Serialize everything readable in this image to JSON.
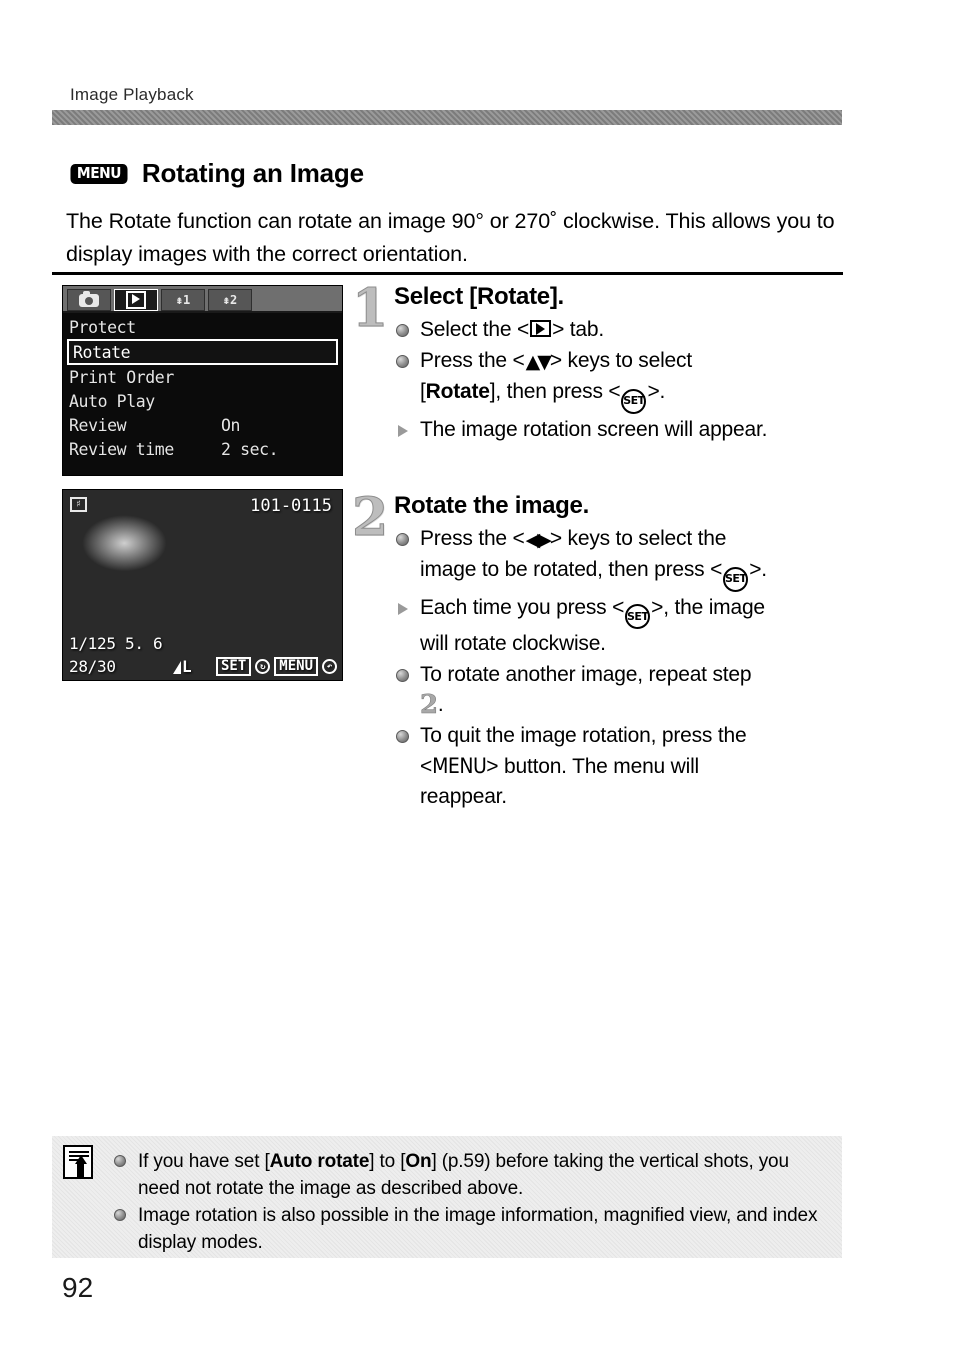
{
  "header": {
    "running_head": "Image Playback"
  },
  "section": {
    "badge": "MENU",
    "title": "Rotating an Image",
    "intro": "The Rotate function can rotate an image 90° or 270˚ clockwise. This allows you to display images with the correct orientation."
  },
  "menu_screen": {
    "tabs": [
      {
        "icon": "camera-icon",
        "label": "",
        "active": false
      },
      {
        "icon": "playback-icon",
        "label": "",
        "active": true
      },
      {
        "icon": "wrench-icon",
        "label": "1",
        "active": false
      },
      {
        "icon": "wrench-icon",
        "label": "2",
        "active": false
      }
    ],
    "items": [
      {
        "label": "Protect",
        "value": "",
        "selected": false
      },
      {
        "label": "Rotate",
        "value": "",
        "selected": true
      },
      {
        "label": "Print Order",
        "value": "",
        "selected": false
      },
      {
        "label": "Auto Play",
        "value": "",
        "selected": false
      },
      {
        "label": "Review",
        "value": "On",
        "selected": false
      },
      {
        "label": "Review time",
        "value": "2 sec.",
        "selected": false
      }
    ]
  },
  "photo_screen": {
    "protect_icon": "protect-icon",
    "file_number": "101-0115",
    "exposure": "1/125   5. 6",
    "frame_count": "28/30",
    "quality": "L",
    "set_hint": "SET",
    "menu_hint": "MENU"
  },
  "steps": [
    {
      "number": "1",
      "title": "Select [Rotate].",
      "lines": [
        {
          "marker": "dot",
          "before": "Select the <",
          "glyph": "play-tab-icon",
          "after": "> tab."
        },
        {
          "marker": "dot",
          "before": "Press the <",
          "glyph": "up-down-arrows-icon",
          "after": "> keys to select [Rotate], then press <",
          "glyph2": "set-button-icon",
          "after2": ">."
        },
        {
          "marker": "triangle",
          "before": "The image rotation screen will appear.",
          "glyph": "",
          "after": ""
        }
      ]
    },
    {
      "number": "2",
      "title": "Rotate the image.",
      "lines": [
        {
          "marker": "dot",
          "before": "Press the <",
          "glyph": "left-right-arrows-icon",
          "after": "> keys to select the image to be rotated, then press <",
          "glyph2": "set-button-icon",
          "after2": ">."
        },
        {
          "marker": "triangle",
          "before": "Each time you press <",
          "glyph": "set-button-icon",
          "after": ">, the image will rotate clockwise."
        },
        {
          "marker": "dot",
          "before": "To rotate another image, repeat step",
          "glyph": "step-2-ref",
          "after": "."
        },
        {
          "marker": "dot",
          "before": "To quit the image rotation, press the <",
          "glyph": "menu-word",
          "after": "> button. The menu will reappear."
        }
      ]
    }
  ],
  "step_labels": {
    "s1_title": "Select [Rotate].",
    "s1_b1_a": "Select the <",
    "s1_b1_b": "> tab.",
    "s1_b2_a": "Press the <",
    "s1_b2_b": "> keys to select",
    "s1_b2_c": "[",
    "s1_b2_rotate": "Rotate",
    "s1_b2_d": "], then press <",
    "s1_b2_e": ">.",
    "s1_b3": "The image rotation screen will appear.",
    "s2_title": "Rotate the image.",
    "s2_b1_a": "Press the <",
    "s2_b1_b": "> keys to select the",
    "s2_b1_c": "image to be rotated, then press <",
    "s2_b1_d": ">.",
    "s2_b2_a": "Each time you press <",
    "s2_b2_b": ">, the image",
    "s2_b2_c": "will rotate clockwise.",
    "s2_b3_a": "To rotate another image, repeat step",
    "s2_b3_num": "2",
    "s2_b3_b": ".",
    "s2_b4_a": "To quit the image rotation, press the",
    "s2_b4_lt": "<",
    "s2_b4_menu": "MENU",
    "s2_b4_gt": ">",
    "s2_b4_b": "button. The menu will",
    "s2_b4_c": "reappear.",
    "set_label": "SET",
    "num1": "1",
    "num2": "2"
  },
  "note": {
    "icon": "note-pencil-icon",
    "items": [
      {
        "p1": "If you have set [",
        "b1": "Auto rotate",
        "p2": "] to [",
        "b2": "On",
        "p3": "] (p.59) before taking the vertical shots, you need not rotate the image as described above."
      },
      {
        "p1": "Image rotation is also possible in the image information, magnified view, and index display modes.",
        "b1": "",
        "p2": "",
        "b2": "",
        "p3": ""
      }
    ]
  },
  "folio": "92"
}
